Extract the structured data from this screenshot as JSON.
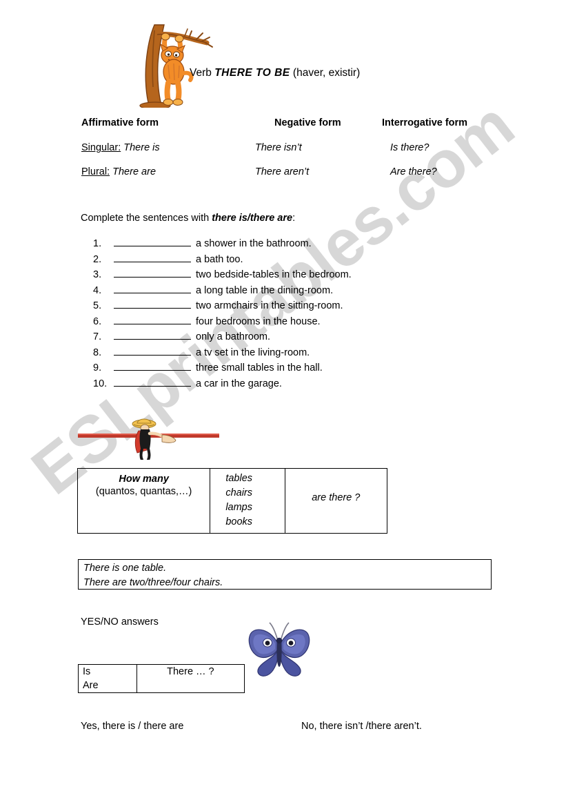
{
  "title": {
    "prefix": "Verb ",
    "emphasis": "THERE TO BE",
    "suffix": " (haver, existir)"
  },
  "forms": {
    "headers": [
      "Affirmative form",
      "Negative form",
      "Interrogative form"
    ],
    "rows": [
      {
        "label": "Singular:",
        "affirmative": "There is",
        "negative": "There isn’t",
        "interrogative": "Is there?"
      },
      {
        "label": "Plural:",
        "affirmative": "There are",
        "negative": "There aren’t",
        "interrogative": "Are there?"
      }
    ]
  },
  "exercise": {
    "instruction_prefix": "Complete the sentences with ",
    "instruction_emphasis": "there is/there are",
    "instruction_suffix": ":",
    "items": [
      {
        "number": "1.",
        "text": "a shower in the bathroom."
      },
      {
        "number": "2.",
        "text": "a bath too."
      },
      {
        "number": "3.",
        "text": "two bedside-tables in the bedroom."
      },
      {
        "number": "4.",
        "text": "a long table in the dining-room."
      },
      {
        "number": "5.",
        "text": "two armchairs in the sitting-room."
      },
      {
        "number": "6.",
        "text": "four bedrooms in the house."
      },
      {
        "number": "7.",
        "text": "only a bathroom."
      },
      {
        "number": "8.",
        "text": "a tv set in the living-room."
      },
      {
        "number": "9.",
        "text": "three small tables in the hall."
      },
      {
        "number": "10.",
        "text": "a car in the garage."
      }
    ]
  },
  "how_many_table": {
    "question_word": "How many",
    "translation": "(quantos, quantas,…)",
    "nouns": [
      "tables",
      "chairs",
      "lamps",
      "books"
    ],
    "tail": "are there ?"
  },
  "example_box": {
    "line1": "There is one table.",
    "line2": "There are two/three/four chairs."
  },
  "yes_no": {
    "heading": "YES/NO answers",
    "aux_options": [
      "Is",
      "Are"
    ],
    "pattern": "There … ?",
    "affirmative_answer": "Yes, there is / there are",
    "negative_answer": "No, there isn’t /there aren’t."
  },
  "watermark": {
    "text": "ESLprintables.com",
    "color": "#c9c9c9"
  },
  "clipart": {
    "cat_tree": "cat-hanging-from-tree-clipart",
    "divider": "red-bar-with-cartoon-figure-clipart",
    "butterfly": "blue-butterfly-clipart"
  },
  "colors": {
    "divider_bar": "#c0392b",
    "tree": "#b5651d",
    "cat": "#f28c28",
    "butterfly": "#4a4f9e"
  }
}
